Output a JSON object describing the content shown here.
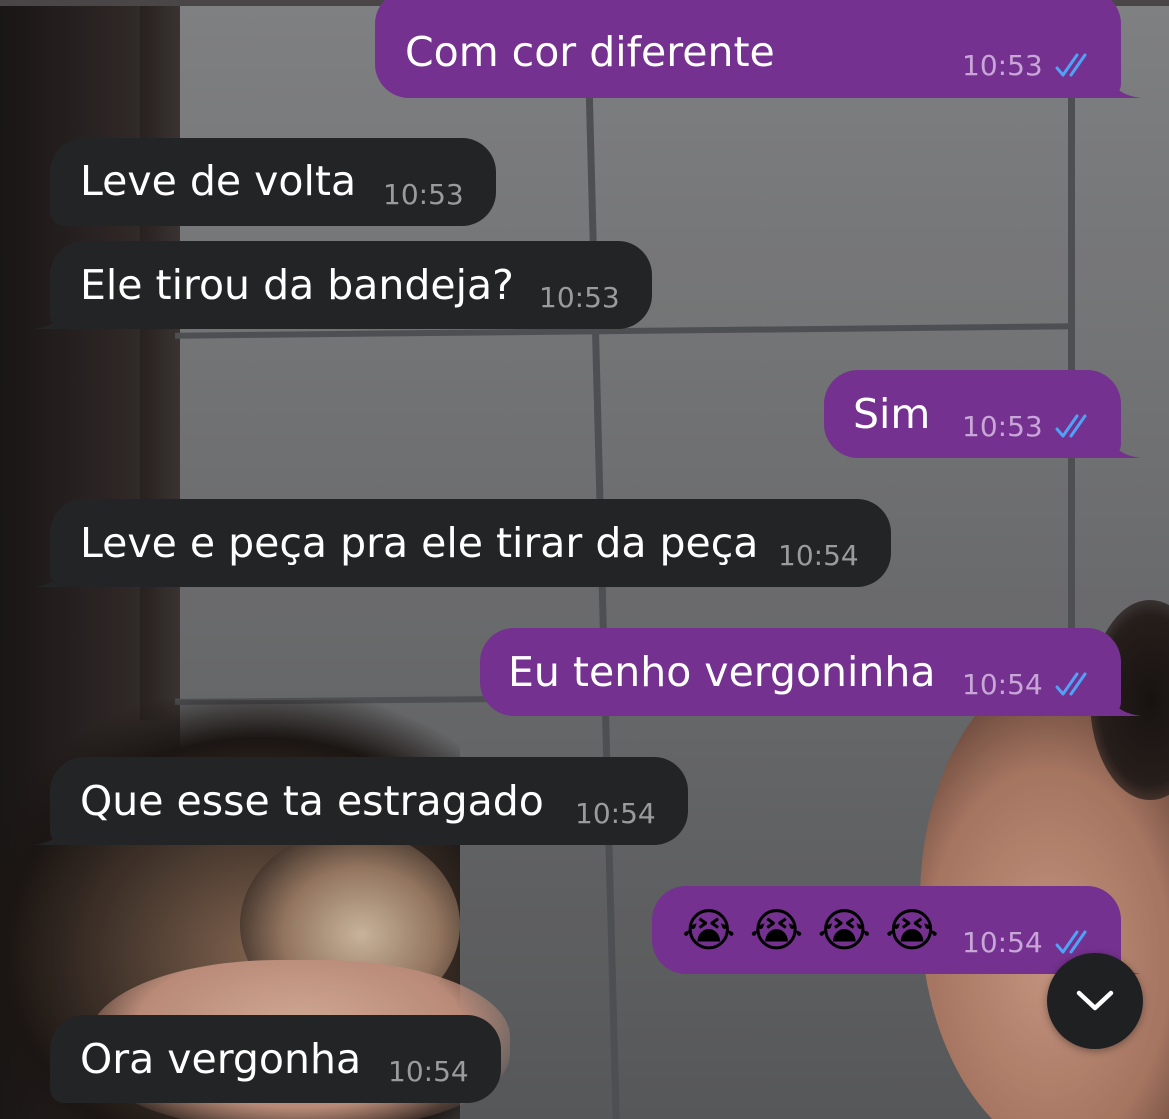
{
  "messages": [
    {
      "direction": "out",
      "text": "Com cor diferente",
      "time": "10:53",
      "status": "read"
    },
    {
      "direction": "in",
      "text": "Leve de volta",
      "time": "10:53"
    },
    {
      "direction": "in",
      "text": "Ele tirou da bandeja?",
      "time": "10:53"
    },
    {
      "direction": "out",
      "text": "Sim",
      "time": "10:53",
      "status": "read"
    },
    {
      "direction": "in",
      "text": "Leve e peça pra ele tirar da peça",
      "time": "10:54"
    },
    {
      "direction": "out",
      "text": "Eu tenho vergoninha",
      "time": "10:54",
      "status": "read"
    },
    {
      "direction": "in",
      "text": "Que esse ta estragado",
      "time": "10:54"
    },
    {
      "direction": "out",
      "text": "😭😭😭😭",
      "emojis": [
        "😭",
        "😭",
        "😭",
        "😭"
      ],
      "time": "10:54",
      "status": "read"
    },
    {
      "direction": "in",
      "text": "Ora vergonha",
      "time": "10:54"
    }
  ],
  "scroll_button": {
    "icon": "chevron-down-icon"
  },
  "colors": {
    "incoming_bubble": "#232425",
    "outgoing_bubble": "#74318f",
    "read_checks": "#4fa3f7",
    "scroll_button": "#1f2021"
  }
}
